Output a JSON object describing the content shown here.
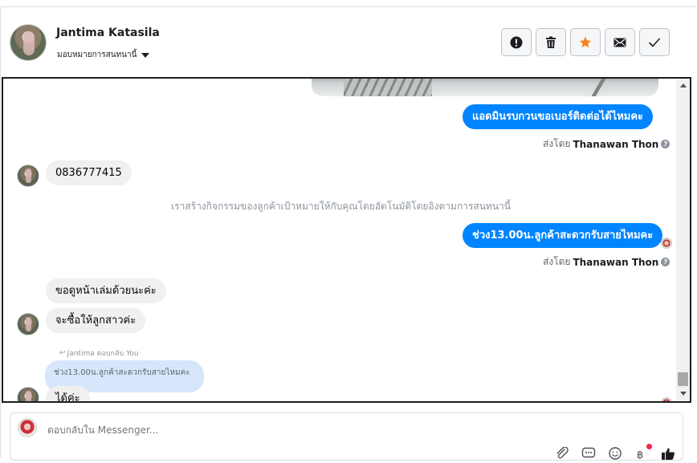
{
  "header": {
    "contact_name": "Jantima Katasila",
    "assign_label": "มอบหมายการสนทนานี้",
    "actions": [
      {
        "name": "report-button",
        "icon": "exclamation-circle-icon"
      },
      {
        "name": "delete-button",
        "icon": "trash-icon"
      },
      {
        "name": "star-button",
        "icon": "star-icon"
      },
      {
        "name": "mark-unread-button",
        "icon": "envelope-icon"
      },
      {
        "name": "mark-done-button",
        "icon": "checkmark-icon"
      }
    ]
  },
  "messages": {
    "m1": "แอดมินรบกวนขอเบอร์ติดต่อได้ไหมคะ",
    "m1_sent_by_prefix": "ส่งโดย",
    "m1_sent_by_name": "Thanawan Thon",
    "m2": "0836777415",
    "system_note": "เราสร้างกิจกรรมของลูกค้าเป้าหมายให้กับคุณโดยอัตโนมัติโดยอิงตามการสนทนานี้",
    "m3": "ช่วง13.00น.ลูกค้าสะดวกรับสายไหมคะ",
    "m3_sent_by_prefix": "ส่งโดย",
    "m3_sent_by_name": "Thanawan Thon",
    "m4": "ขอดูหน้าเล่มด้วยนะค่ะ",
    "m5": "จะซื้อให้ลูกสาวค่ะ",
    "reply_note": "Jantima ตอบกลับ You",
    "quoted_text": "ช่วง13.00น.ลูกค้าสะดวกรับสายไหมคะ",
    "m6": "ได้ค่ะ"
  },
  "composer": {
    "placeholder": "ตอบกลับใน Messenger...",
    "icons": [
      "paperclip-icon",
      "chat-template-icon",
      "emoji-icon",
      "currency-icon",
      "thumbs-up-icon"
    ]
  },
  "colors": {
    "outgoing_bubble": "#0084ff",
    "incoming_bubble": "#f0f0f0",
    "quoted_bubble": "#d6e6fb",
    "star": "#f5821f"
  }
}
